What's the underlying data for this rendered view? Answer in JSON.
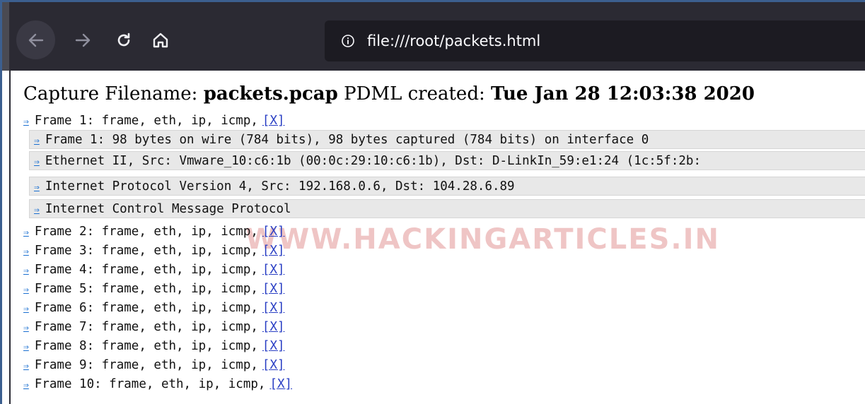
{
  "browser": {
    "url": "file:///root/packets.html"
  },
  "header": {
    "filename_label": "Capture Filename:",
    "filename": "packets.pcap",
    "created_label": "PDML created:",
    "created": "Tue Jan 28 12:03:38 2020"
  },
  "frames": [
    {
      "text": "Frame 1: frame, eth, ip, icmp,",
      "link": "[X]"
    },
    {
      "text": "Frame 2: frame, eth, ip, icmp,",
      "link": "[X]"
    },
    {
      "text": "Frame 3: frame, eth, ip, icmp,",
      "link": "[X]"
    },
    {
      "text": "Frame 4: frame, eth, ip, icmp,",
      "link": "[X]"
    },
    {
      "text": "Frame 5: frame, eth, ip, icmp,",
      "link": "[X]"
    },
    {
      "text": "Frame 6: frame, eth, ip, icmp,",
      "link": "[X]"
    },
    {
      "text": "Frame 7: frame, eth, ip, icmp,",
      "link": "[X]"
    },
    {
      "text": "Frame 8: frame, eth, ip, icmp,",
      "link": "[X]"
    },
    {
      "text": "Frame 9: frame, eth, ip, icmp,",
      "link": "[X]"
    },
    {
      "text": "Frame 10: frame, eth, ip, icmp,",
      "link": "[X]"
    }
  ],
  "details": [
    "Frame 1: 98 bytes on wire (784 bits), 98 bytes captured (784 bits) on interface 0",
    "Ethernet II, Src: Vmware_10:c6:1b (00:0c:29:10:c6:1b), Dst: D-LinkIn_59:e1:24 (1c:5f:2b:",
    "Internet Protocol Version 4, Src: 192.168.0.6, Dst: 104.28.6.89",
    "Internet Control Message Protocol"
  ],
  "arrow_glyph": "⇒",
  "watermark": "WWW.HACKINGARTICLES.IN",
  "colors": {
    "toolbar": "#2b2a33",
    "urlbar": "#1c1b22",
    "detail_bg": "#e8e8e8",
    "link": "#2a3fc4"
  }
}
